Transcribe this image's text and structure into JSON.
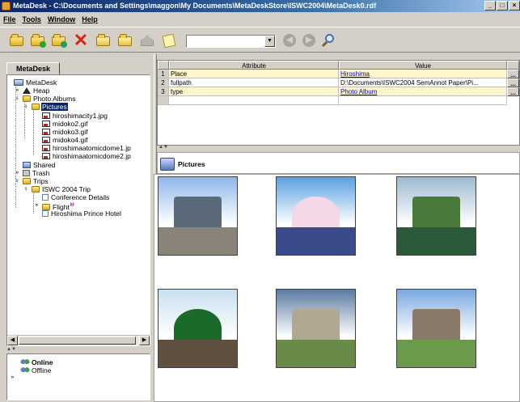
{
  "window": {
    "title": "MetaDesk - C:\\Documents and Settings\\maggon\\My Documents\\MetaDeskStore\\ISWC2004\\MetaDesk0.rdf",
    "min": "_",
    "max": "□",
    "close": "×"
  },
  "menu": [
    "File",
    "Tools",
    "Window",
    "Help"
  ],
  "toolbar": {
    "search_value": "",
    "icons": [
      "open-folder-icon",
      "new-folder-icon",
      "add-folder-icon",
      "delete-icon",
      "edit-icon",
      "edit-alt-icon",
      "home-icon",
      "note-icon",
      "back-icon",
      "forward-icon",
      "search-icon"
    ],
    "accent": "#e02010"
  },
  "left": {
    "tab": "MetaDesk",
    "tree": [
      {
        "label": "MetaDesk",
        "icon": "root",
        "depth": 0,
        "handle": ""
      },
      {
        "label": "Heap",
        "icon": "heap",
        "depth": 1,
        "handle": "o-"
      },
      {
        "label": "Photo Albums",
        "icon": "folder",
        "depth": 1,
        "handle": "o"
      },
      {
        "label": "Pictures",
        "icon": "folder",
        "depth": 2,
        "handle": "o",
        "selected": true
      },
      {
        "label": "hiroshimacity1.jpg",
        "icon": "gif",
        "depth": 3,
        "handle": ""
      },
      {
        "label": "midoko2.gif",
        "icon": "gif",
        "depth": 3,
        "handle": ""
      },
      {
        "label": "midoko3.gif",
        "icon": "gif",
        "depth": 3,
        "handle": ""
      },
      {
        "label": "midoko4.gif",
        "icon": "gif",
        "depth": 3,
        "handle": ""
      },
      {
        "label": "hiroshimaatomicdome1.jp",
        "icon": "gif",
        "depth": 3,
        "handle": ""
      },
      {
        "label": "hiroshimaatomicdome2.jp",
        "icon": "gif",
        "depth": 3,
        "handle": ""
      },
      {
        "label": "Shared",
        "icon": "shared",
        "depth": 1,
        "handle": ""
      },
      {
        "label": "Trash",
        "icon": "trash",
        "depth": 1,
        "handle": "o-"
      },
      {
        "label": "Trips",
        "icon": "folder",
        "depth": 1,
        "handle": "o"
      },
      {
        "label": "ISWC 2004 Trip",
        "icon": "folder",
        "depth": 2,
        "handle": "o"
      },
      {
        "label": "Conference Details",
        "icon": "doc",
        "depth": 3,
        "handle": ""
      },
      {
        "label": "Flight",
        "icon": "folder",
        "depth": 3,
        "handle": "o-",
        "mark": "M"
      },
      {
        "label": "Hiroshima Prince Hotel",
        "icon": "doc",
        "depth": 3,
        "handle": ""
      }
    ],
    "online": [
      {
        "label": "Online",
        "bold": true,
        "handle": ""
      },
      {
        "label": "Offline",
        "bold": false,
        "handle": "o-"
      }
    ]
  },
  "attributes": {
    "headers": [
      "Attribute",
      "Value"
    ],
    "rows": [
      {
        "num": "1",
        "attr": "Place",
        "value": "Hiroshima",
        "link": true
      },
      {
        "num": "2",
        "attr": "fullpath",
        "value": "D:\\Documents\\ISWC2004 SemAnnot Paper\\Pi...",
        "link": false
      },
      {
        "num": "3",
        "attr": "type",
        "value": "Photo Album",
        "link": true
      }
    ],
    "edit_label": "..."
  },
  "pictures": {
    "title": "Pictures",
    "thumbs": [
      {
        "name": "hiroshimacity1.jpg",
        "sky": "#8fb6e8",
        "ground": "#8a8478",
        "mid": "#5a6a78"
      },
      {
        "name": "midoko2.gif",
        "sky": "#5aa0e0",
        "ground": "#3a4a8a",
        "mid": "#f4d8e8"
      },
      {
        "name": "midoko3.gif",
        "sky": "#9cbad0",
        "ground": "#2a5a3a",
        "mid": "#4a7a3a"
      },
      {
        "name": "midoko4.gif",
        "sky": "#c8e0f0",
        "ground": "#605040",
        "mid": "#1a6a2a"
      },
      {
        "name": "hiroshimaatomicdome1.jp",
        "sky": "#5a7aa0",
        "ground": "#6a8a4a",
        "mid": "#b0a890"
      },
      {
        "name": "hiroshimaatomicdome2.jp",
        "sky": "#7aa8e0",
        "ground": "#6a9a4a",
        "mid": "#8a7a6a"
      }
    ]
  }
}
